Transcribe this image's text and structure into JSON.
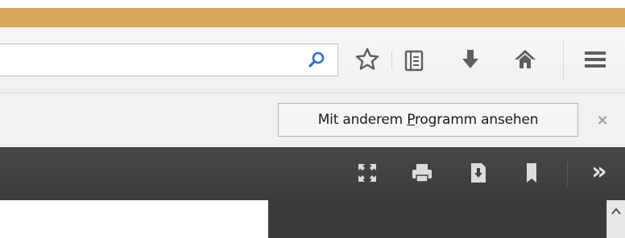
{
  "browser": {
    "urlbar": {
      "value": "",
      "placeholder": ""
    },
    "toolbar_icons": [
      "search-icon",
      "star-icon",
      "reader-list-icon",
      "download-icon",
      "home-icon",
      "menu-icon"
    ]
  },
  "notification": {
    "open_with_prefix": "Mit anderem ",
    "open_with_accel": "P",
    "open_with_suffix": "rogramm ansehen",
    "close_glyph": "×"
  },
  "pdf_toolbar": {
    "icons": [
      "fullscreen-icon",
      "print-icon",
      "save-icon",
      "bookmark-icon"
    ],
    "more_glyph": "»"
  },
  "colors": {
    "title_bar": "#d7a85a",
    "nav_toolbar": "#f4f4f4",
    "icon_gray": "#5e5e5e",
    "search_blue": "#2f6ec4",
    "pdf_toolbar": "#414141",
    "pdf_icon": "#dcdcdc"
  }
}
